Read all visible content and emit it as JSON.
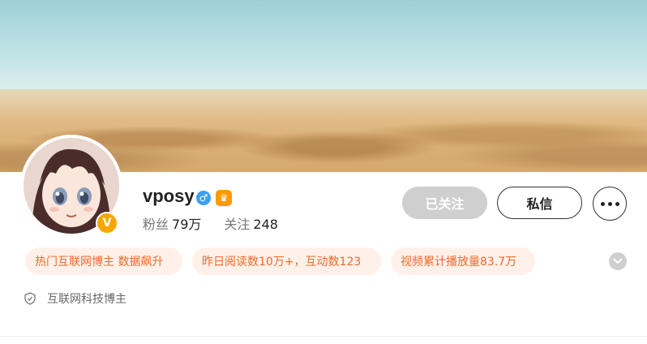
{
  "profile": {
    "username": "vposy",
    "gender_icon": "male-icon",
    "gender_symbol": "♂",
    "vip_icon": "vip-crown-icon",
    "vip_symbol": "♛",
    "verified_symbol": "V",
    "fans_label": "粉丝",
    "fans_count": "79万",
    "following_label": "关注",
    "following_count": "248"
  },
  "actions": {
    "followed_label": "已关注",
    "message_label": "私信",
    "more_icon": "more-dots-icon"
  },
  "tags": [
    {
      "text": "热门互联网博主 数据飙升"
    },
    {
      "text": "昨日阅读数10万+，互动数123"
    },
    {
      "text": "视频累计播放量83.7万"
    }
  ],
  "field": {
    "icon": "shield-icon",
    "text": "互联网科技博主"
  },
  "colors": {
    "accent_orange": "#ee6a2a",
    "tag_bg": "#fff1ea",
    "verified_badge": "#f7a600",
    "gender_blue": "#3b9ff2"
  }
}
